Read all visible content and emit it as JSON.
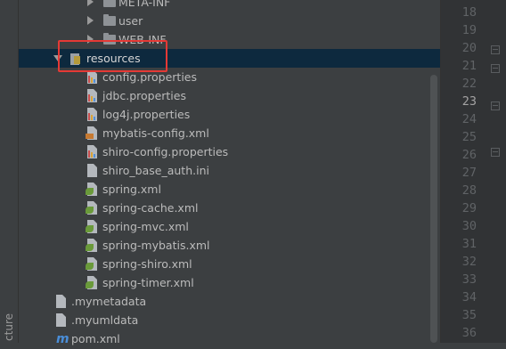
{
  "side_panel": {
    "label": "cture"
  },
  "tree": {
    "items": [
      {
        "label": "META-INF",
        "kind": "folder",
        "expand": "right"
      },
      {
        "label": "user",
        "kind": "folder",
        "expand": "right"
      },
      {
        "label": "WEB-INF",
        "kind": "folder",
        "expand": "right"
      },
      {
        "label": "resources",
        "kind": "resources-folder",
        "expand": "down",
        "selected": true
      },
      {
        "label": "config.properties",
        "kind": "properties"
      },
      {
        "label": "jdbc.properties",
        "kind": "properties"
      },
      {
        "label": "log4j.properties",
        "kind": "properties"
      },
      {
        "label": "mybatis-config.xml",
        "kind": "xml"
      },
      {
        "label": "shiro-config.properties",
        "kind": "properties"
      },
      {
        "label": "shiro_base_auth.ini",
        "kind": "text-file"
      },
      {
        "label": "spring.xml",
        "kind": "spring-xml"
      },
      {
        "label": "spring-cache.xml",
        "kind": "spring-xml"
      },
      {
        "label": "spring-mvc.xml",
        "kind": "spring-xml"
      },
      {
        "label": "spring-mybatis.xml",
        "kind": "spring-xml"
      },
      {
        "label": "spring-shiro.xml",
        "kind": "spring-xml"
      },
      {
        "label": "spring-timer.xml",
        "kind": "spring-xml"
      },
      {
        "label": ".mymetadata",
        "kind": "text-file"
      },
      {
        "label": ".myumldata",
        "kind": "text-file"
      },
      {
        "label": "pom.xml",
        "kind": "maven"
      }
    ]
  },
  "gutter": {
    "line_numbers": [
      "18",
      "19",
      "20",
      "21",
      "22",
      "23",
      "24",
      "25",
      "26",
      "27",
      "28",
      "29",
      "30",
      "31",
      "32",
      "33",
      "34",
      "35",
      "36"
    ],
    "current_line": "23"
  },
  "colors": {
    "annotation_box": "#e53935",
    "selection": "#0d293e",
    "panel_bg": "#3c3f41",
    "gutter_bg": "#313335"
  }
}
